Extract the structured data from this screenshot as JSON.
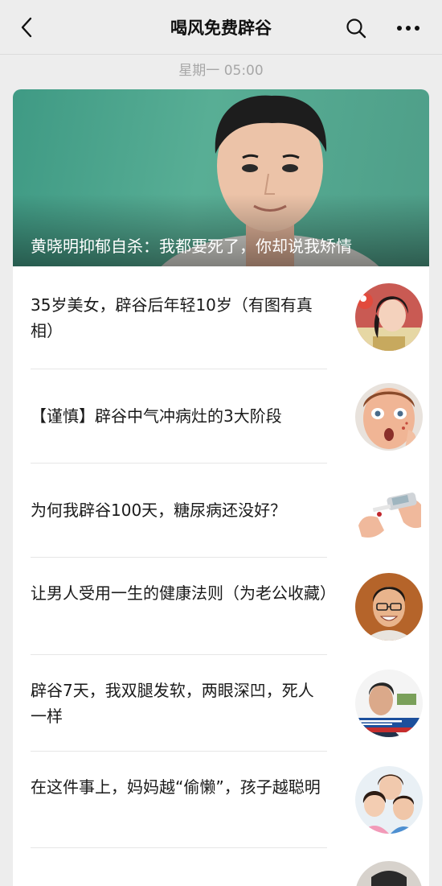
{
  "navbar": {
    "title": "喝风免费辟谷",
    "back_icon": "chevron-left-icon",
    "search_icon": "search-icon",
    "more_icon": "more-dots-icon"
  },
  "timestamp": "星期一 05:00",
  "hero": {
    "title": "黄晓明抑郁自杀：我都要死了，你却说我矫情",
    "accent_color": "#4ea58d"
  },
  "articles": [
    {
      "title": "35岁美女，辟谷后年轻10岁（有图有真相）",
      "thumb": "woman-avatar"
    },
    {
      "title": "【谨慎】辟谷中气冲病灶的3大阶段",
      "thumb": "surprised-woman"
    },
    {
      "title": "为何我辟谷100天，糖尿病还没好？",
      "thumb": "glucose-meter"
    },
    {
      "title": "让男人受用一生的健康法则（为老公收藏）",
      "thumb": "smiling-man"
    },
    {
      "title": "辟谷7天，我双腿发软，两眼深凹，死人一样",
      "thumb": "tv-news-man"
    },
    {
      "title": "在这件事上，妈妈越“偷懒”，孩子越聪明",
      "thumb": "mother-children"
    }
  ]
}
